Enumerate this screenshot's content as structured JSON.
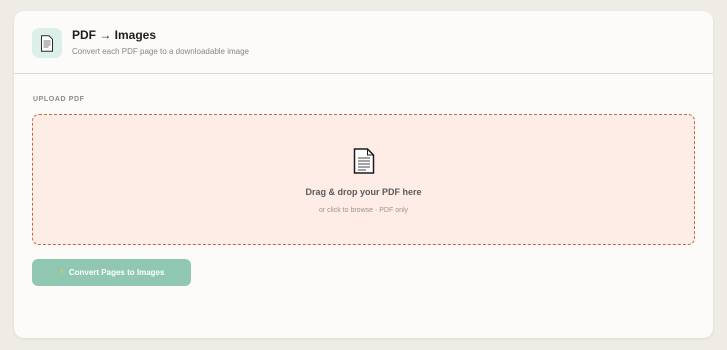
{
  "header": {
    "icon": "document-icon",
    "title": "PDF → Images",
    "subtitle": "Convert each PDF page to a downloadable image"
  },
  "upload": {
    "section_label": "UPLOAD PDF",
    "icon": "document-icon",
    "dropzone_title": "Drag & drop your PDF here",
    "dropzone_subtitle": "or click to browse · PDF only"
  },
  "actions": {
    "convert_icon": "lightning-icon",
    "convert_label": "Convert Pages to Images"
  },
  "colors": {
    "accent": "#8fc7b1",
    "dropzone_bg": "#feede7",
    "dropzone_border": "#c7693f",
    "header_icon_bg": "#dcf0ea"
  }
}
